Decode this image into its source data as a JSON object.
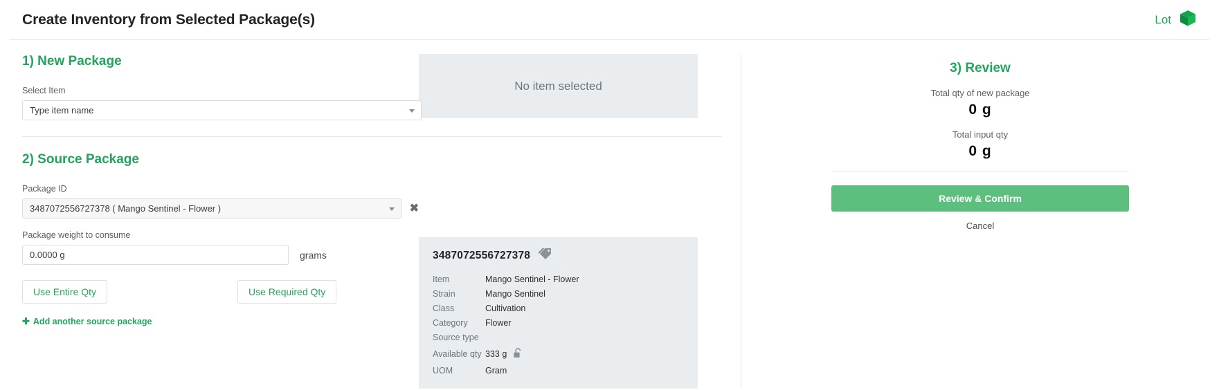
{
  "header": {
    "title": "Create Inventory from Selected Package(s)",
    "lot_label": "Lot",
    "lot_icon": "cube-icon",
    "accent_color": "#22a45d"
  },
  "new_package": {
    "section_title": "1) New Package",
    "select_item_label": "Select Item",
    "select_item_value": "Type item name",
    "caret_icon": "chevron-down-icon"
  },
  "source_package": {
    "section_title": "2) Source Package",
    "package_id_label": "Package ID",
    "package_id_value": "3487072556727378 ( Mango Sentinel - Flower )",
    "clear_icon": "close-icon",
    "weight_label": "Package weight to consume",
    "weight_value": "0.0000 g",
    "weight_placeholder": "0.0000 g",
    "grams_unit": "grams",
    "use_entire_qty": "Use Entire Qty",
    "use_required_qty": "Use Required Qty",
    "add_another": "Add another source package",
    "add_icon": "plus-icon"
  },
  "preview": {
    "no_item_selected": "No item selected"
  },
  "detail": {
    "package_id": "3487072556727378",
    "tag_icon": "tag-icon",
    "lock_icon": "lock-open-icon",
    "rows": [
      {
        "key": "Item",
        "value": "Mango Sentinel - Flower"
      },
      {
        "key": "Strain",
        "value": "Mango Sentinel"
      },
      {
        "key": "Class",
        "value": "Cultivation"
      },
      {
        "key": "Category",
        "value": "Flower"
      },
      {
        "key": "Source type",
        "value": ""
      },
      {
        "key": "Available qty",
        "value": "333 g"
      },
      {
        "key": "UOM",
        "value": "Gram"
      }
    ]
  },
  "review": {
    "section_title": "3) Review",
    "total_new_label": "Total qty of new package",
    "total_new_value": "0 g",
    "total_input_label": "Total input qty",
    "total_input_value": "0 g",
    "confirm_label": "Review & Confirm",
    "cancel_label": "Cancel",
    "confirm_color": "#5cbf7e"
  }
}
